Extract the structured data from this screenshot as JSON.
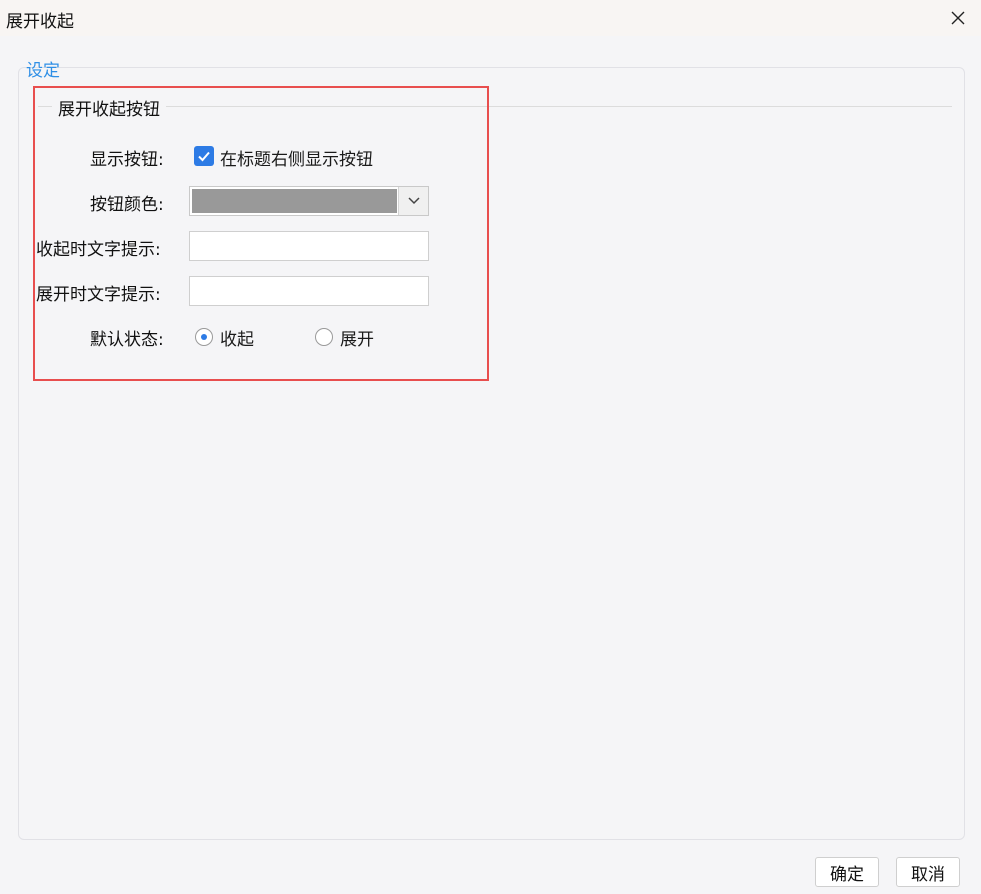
{
  "window": {
    "title": "展开收起"
  },
  "tab": {
    "label": "设定"
  },
  "group": {
    "title": "展开收起按钮"
  },
  "form": {
    "show_button": {
      "label": "显示按钮:",
      "checkbox_text": "在标题右侧显示按钮",
      "checked": true
    },
    "button_color": {
      "label": "按钮颜色:",
      "value": "#999999"
    },
    "collapse_tip": {
      "label": "收起时文字提示:",
      "value": ""
    },
    "expand_tip": {
      "label": "展开时文字提示:",
      "value": ""
    },
    "default_state": {
      "label": "默认状态:",
      "options": [
        {
          "text": "收起",
          "selected": true
        },
        {
          "text": "展开",
          "selected": false
        }
      ]
    }
  },
  "footer": {
    "ok_label": "确定",
    "cancel_label": "取消"
  }
}
